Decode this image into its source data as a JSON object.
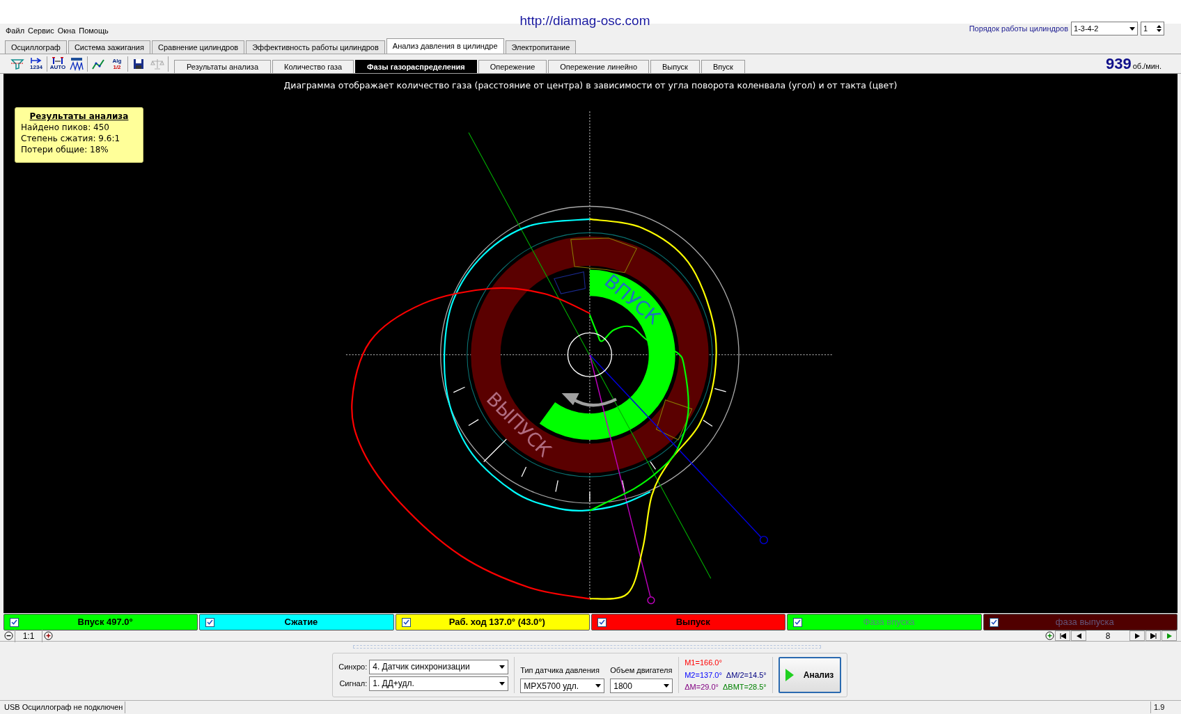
{
  "header": {
    "url": "http://diamag-osc.com"
  },
  "menu": [
    "Файл",
    "Сервис",
    "Окна",
    "Помощь"
  ],
  "cylinder_order": {
    "label": "Порядок работы цилиндров",
    "value": "1-3-4-2",
    "cylinder": "1"
  },
  "tabs": [
    {
      "label": "Осциллограф",
      "selected": false
    },
    {
      "label": "Система зажигания",
      "selected": false
    },
    {
      "label": "Сравнение цилиндров",
      "selected": false
    },
    {
      "label": "Эффективность работы цилиндров",
      "selected": false
    },
    {
      "label": "Анализ давления в цилиндре",
      "selected": true
    },
    {
      "label": "Электропитание",
      "selected": false
    }
  ],
  "toolbar": [
    [
      {
        "kind": "filter",
        "disabled": false
      },
      {
        "kind": "arrow",
        "captions": [
          "1234"
        ],
        "disabled": false
      }
    ],
    [
      {
        "kind": "markers",
        "captions": [
          "AUTO"
        ],
        "disabled": false
      },
      {
        "kind": "peaks",
        "disabled": false
      }
    ],
    [
      {
        "kind": "line",
        "disabled": false
      },
      {
        "kind": "alg",
        "captions": [
          "Alg",
          "1/2"
        ],
        "disabled": false
      }
    ],
    [
      {
        "kind": "save",
        "disabled": false
      },
      {
        "kind": "scales",
        "disabled": true
      }
    ]
  ],
  "subtabs": [
    {
      "label": "Результаты анализа",
      "selected": false
    },
    {
      "label": "Количество газа",
      "selected": false
    },
    {
      "label": "Фазы газораспределения",
      "selected": true
    },
    {
      "label": "Опережение",
      "selected": false
    },
    {
      "label": "Опережение линейно",
      "selected": false
    },
    {
      "label": "Выпуск",
      "selected": false
    },
    {
      "label": "Впуск",
      "selected": false
    }
  ],
  "rpm": {
    "value": "939",
    "unit": "об./мин."
  },
  "diagram": {
    "caption": "Диаграмма отображает количество газа (расстояние от центра) в зависимости от угла поворота коленвала (угол) и от такта (цвет)",
    "results": {
      "title": "Результаты анализа",
      "lines": [
        "Найдено пиков: 450",
        "Степень сжатия: 9.6:1",
        "Потери общие: 18%"
      ]
    },
    "intake_label": "ВПУСК",
    "exhaust_label": "ВЫПУСК"
  },
  "legend": [
    {
      "label": "Впуск 497.0°",
      "checked": true,
      "kind": "stroke",
      "color": "#00ff00"
    },
    {
      "label": "Сжатие",
      "checked": true,
      "kind": "stroke",
      "color": "#00ffff"
    },
    {
      "label": "Раб. ход 137.0° (43.0°)",
      "checked": true,
      "kind": "stroke",
      "color": "#ffff00"
    },
    {
      "label": "Выпуск",
      "checked": true,
      "kind": "stroke",
      "color": "#ff0000"
    },
    {
      "label": "Фаза впуска",
      "checked": true,
      "kind": "phase",
      "color": "#00ff00"
    },
    {
      "label": "фаза выпуска",
      "checked": true,
      "kind": "phase",
      "color": "#500000"
    }
  ],
  "zoom": {
    "label": "1:1"
  },
  "frame": {
    "value": "8"
  },
  "controls": {
    "sync": {
      "label": "Синхро:",
      "value": "4.  Датчик синхронизации"
    },
    "signal": {
      "label": "Сигнал:",
      "value": "1.  ДД+удл."
    },
    "sensor_type": {
      "label": "Тип датчика давления",
      "value": "MPX5700 удл."
    },
    "engine_volume": {
      "label": "Объем двигателя",
      "value": "1800"
    },
    "markers": [
      [
        {
          "text": "M1=166.0°",
          "color": "#ff0000"
        }
      ],
      [
        {
          "text": "M2=137.0°",
          "color": "#0000ff"
        },
        {
          "text": "ΔM/2=14.5°",
          "color": "#000080"
        }
      ],
      [
        {
          "text": "ΔM=29.0°",
          "color": "#800080"
        },
        {
          "text": "ΔВМТ=28.5°",
          "color": "#008000"
        }
      ]
    ],
    "analyze_button": "Анализ"
  },
  "status_bar": {
    "message": "USB Осциллограф не подключен",
    "version": "1.9"
  }
}
